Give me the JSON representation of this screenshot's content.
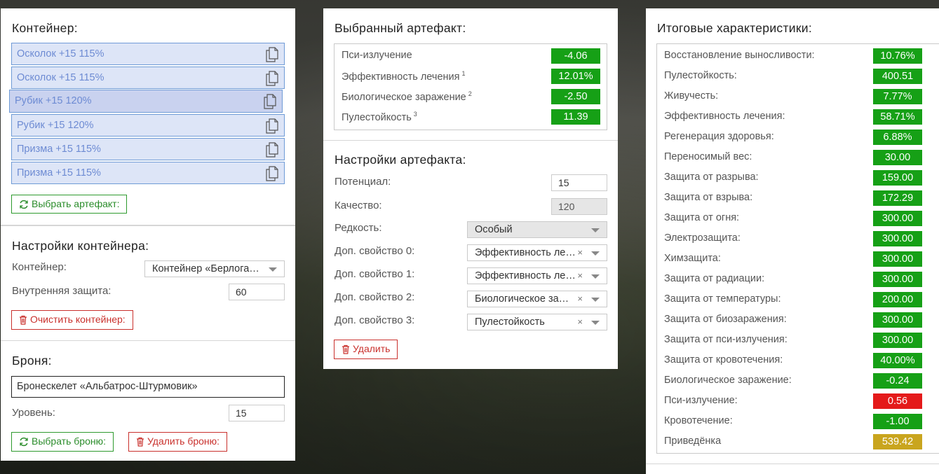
{
  "container_panel": {
    "title": "Контейнер:",
    "slots": [
      {
        "label": "Осколок +15 115%"
      },
      {
        "label": "Осколок +15 115%"
      },
      {
        "label": "Рубик +15 120%"
      },
      {
        "label": "Рубик +15 120%"
      },
      {
        "label": "Призма +15 115%"
      },
      {
        "label": "Призма +15 115%"
      }
    ],
    "select_artifact_label": "Выбрать артефакт:"
  },
  "container_settings": {
    "title": "Настройки контейнера:",
    "container_label": "Контейнер:",
    "container_value": "Контейнер «Берлога…",
    "inner_protection_label": "Внутренняя защита:",
    "inner_protection_value": "60",
    "clear_label": "Очистить контейнер:"
  },
  "armor": {
    "title": "Броня:",
    "name": "Бронескелет «Альбатрос-Штурмовик»",
    "level_label": "Уровень:",
    "level_value": "15",
    "select_label": "Выбрать броню:",
    "delete_label": "Удалить броню:"
  },
  "selected_artifact": {
    "title": "Выбранный артефакт:",
    "stats": [
      {
        "name": "Пси-излучение",
        "sup": "",
        "value": "-4.06"
      },
      {
        "name": "Эффективность лечения",
        "sup": "1",
        "value": "12.01%"
      },
      {
        "name": "Биологическое заражение",
        "sup": "2",
        "value": "-2.50"
      },
      {
        "name": "Пулестойкость",
        "sup": "3",
        "value": "11.39"
      }
    ]
  },
  "artifact_settings": {
    "title": "Настройки артефакта:",
    "potential_label": "Потенциал:",
    "potential_value": "15",
    "quality_label": "Качество:",
    "quality_value": "120",
    "rarity_label": "Редкость:",
    "rarity_value": "Особый",
    "extra": [
      {
        "label": "Доп. свойство 0:",
        "value": "Эффективность ле…"
      },
      {
        "label": "Доп. свойство 1:",
        "value": "Эффективность ле…"
      },
      {
        "label": "Доп. свойство 2:",
        "value": "Биологическое за…"
      },
      {
        "label": "Доп. свойство 3:",
        "value": "Пулестойкость"
      }
    ],
    "clear_symbol": "×",
    "delete_label": "Удалить"
  },
  "totals": {
    "title": "Итоговые характеристики:",
    "stats": [
      {
        "name": "Восстановление выносливости:",
        "value": "10.76%",
        "color": "green"
      },
      {
        "name": "Пулестойкость:",
        "value": "400.51",
        "color": "green"
      },
      {
        "name": "Живучесть:",
        "value": "7.77%",
        "color": "green"
      },
      {
        "name": "Эффективность лечения:",
        "value": "58.71%",
        "color": "green"
      },
      {
        "name": "Регенерация здоровья:",
        "value": "6.88%",
        "color": "green"
      },
      {
        "name": "Переносимый вес:",
        "value": "30.00",
        "color": "green"
      },
      {
        "name": "Защита от разрыва:",
        "value": "159.00",
        "color": "green"
      },
      {
        "name": "Защита от взрыва:",
        "value": "172.29",
        "color": "green"
      },
      {
        "name": "Защита от огня:",
        "value": "300.00",
        "color": "green"
      },
      {
        "name": "Электрозащита:",
        "value": "300.00",
        "color": "green"
      },
      {
        "name": "Химзащита:",
        "value": "300.00",
        "color": "green"
      },
      {
        "name": "Защита от радиации:",
        "value": "300.00",
        "color": "green"
      },
      {
        "name": "Защита от температуры:",
        "value": "200.00",
        "color": "green"
      },
      {
        "name": "Защита от биозаражения:",
        "value": "300.00",
        "color": "green"
      },
      {
        "name": "Защита от пси-излучения:",
        "value": "300.00",
        "color": "green"
      },
      {
        "name": "Защита от кровотечения:",
        "value": "40.00%",
        "color": "green"
      },
      {
        "name": "Биологическое заражение:",
        "value": "-0.24",
        "color": "green"
      },
      {
        "name": "Пси-излучение:",
        "value": "0.56",
        "color": "red"
      },
      {
        "name": "Кровотечение:",
        "value": "-1.00",
        "color": "green"
      },
      {
        "name": "Приведёнка",
        "value": "539.42",
        "color": "gold"
      }
    ]
  },
  "colors": {
    "green": "#16a016",
    "red": "#e41a1a",
    "gold": "#c9a51e",
    "slot_blue": "#6d8bd3"
  }
}
